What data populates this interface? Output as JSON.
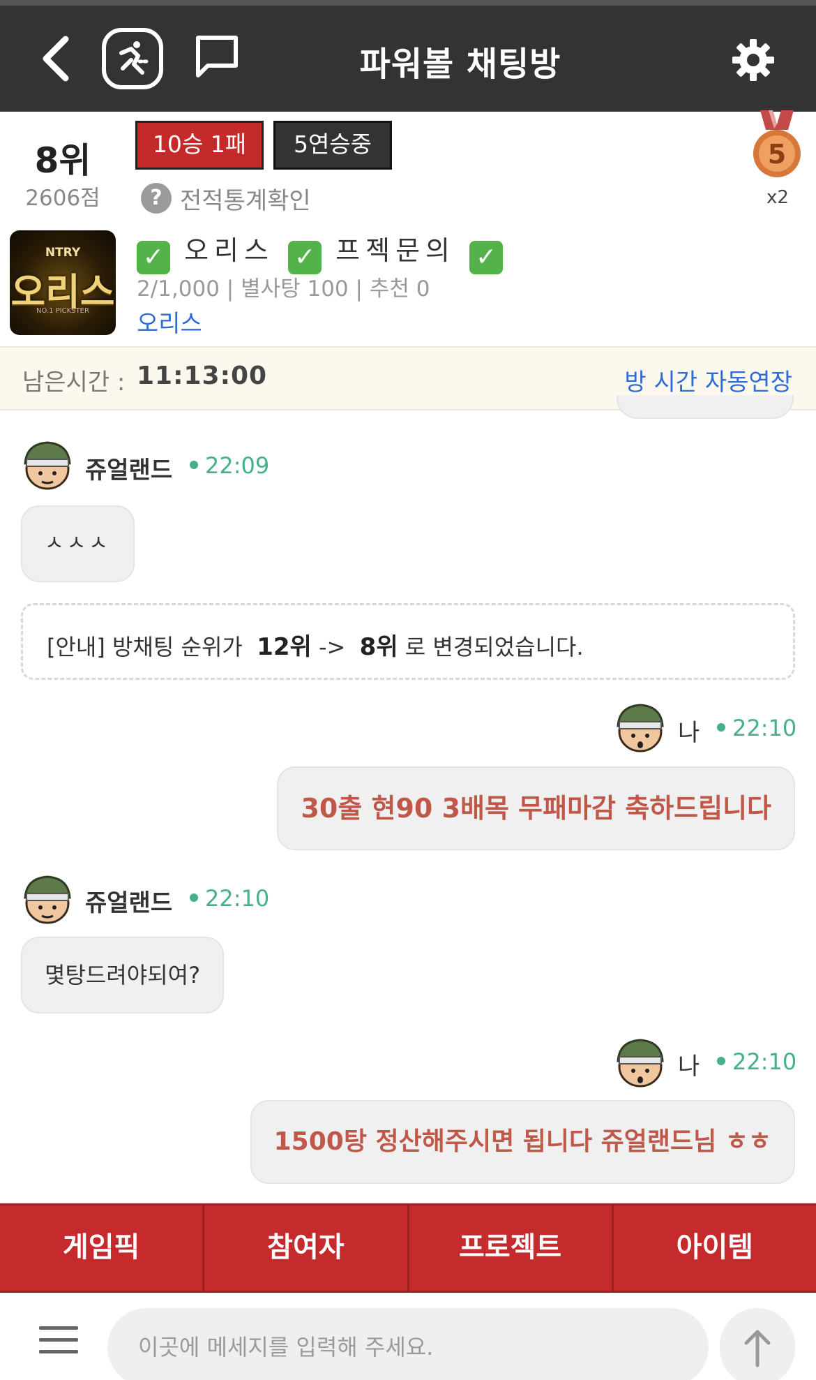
{
  "header": {
    "title": "파워볼 채팅방",
    "back_icon": "back-chevron-icon",
    "logo_icon": "runner-logo-icon",
    "chat_icon": "speech-bubble-icon",
    "settings_icon": "gear-icon"
  },
  "rank": {
    "position": "8위",
    "points": "2606점",
    "record": "10승 1패",
    "streak": "5연승중",
    "stats_link": "전적통계확인",
    "medal_number": "5",
    "medal_count": "x2"
  },
  "room": {
    "thumbnail_brand": "NTRY",
    "thumbnail_title": "오리스",
    "thumbnail_sub": "NO.1 PICKSTER",
    "title_parts": [
      "오리스",
      "프젝문의"
    ],
    "meta": "2/1,000 | 별사탕 100 | 추천 0",
    "owner": "오리스"
  },
  "timer": {
    "label": "남은시간 :",
    "value": "11:13:00",
    "extend_link": "방 시간 자동연장"
  },
  "messages": [
    {
      "user": "쥬얼랜드",
      "time": "22:09",
      "text": "ㅅㅅㅅ"
    },
    {
      "notice_prefix": "[안내] 방채팅 순위가",
      "from_rank": "12위",
      "arrow": "->",
      "to_rank": "8위",
      "notice_suffix": "로 변경되었습니다."
    },
    {
      "user": "나",
      "time": "22:10",
      "text": "30출 현90 3배목 무패마감 축하드립니다"
    },
    {
      "user": "쥬얼랜드",
      "time": "22:10",
      "text": "몇탕드려야되여?"
    },
    {
      "user": "나",
      "time": "22:10",
      "text": "1500탕 정산해주시면 됩니다 쥬얼랜드님 ㅎㅎ"
    }
  ],
  "tabs": [
    "게임픽",
    "참여자",
    "프로젝트",
    "아이템"
  ],
  "input": {
    "placeholder": "이곳에 메세지를 입력해 주세요.",
    "menu_icon": "hamburger-menu-icon",
    "send_icon": "arrow-up-icon"
  },
  "colors": {
    "header_bg": "#333333",
    "accent_red": "#c52b2d",
    "online_green": "#45b08a",
    "link_blue": "#2f6bd6",
    "my_message_text": "#c0584a"
  }
}
